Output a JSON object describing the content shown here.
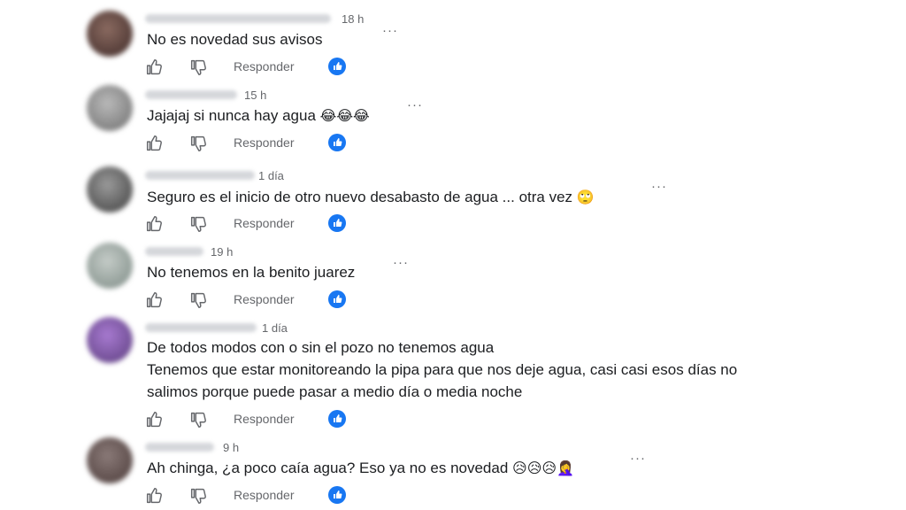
{
  "reply_label": "Responder",
  "more_label": "···",
  "colors": {
    "accent": "#1877f2",
    "muted": "#65676b",
    "text": "#1c1e21"
  },
  "comments": [
    {
      "time": "18 h",
      "lines": [
        "No es novedad sus avisos"
      ],
      "emoji": ""
    },
    {
      "time": "15 h",
      "lines": [
        "Jajajaj si nunca hay agua"
      ],
      "emoji": "😂😂😂"
    },
    {
      "time": "1 día",
      "lines": [
        "Seguro es el inicio de otro nuevo desabasto de agua ... otra vez"
      ],
      "emoji": "🙄"
    },
    {
      "time": "19 h",
      "lines": [
        "No tenemos en la benito juarez"
      ],
      "emoji": ""
    },
    {
      "time": "1 día",
      "lines": [
        "De todos modos con o sin el pozo no tenemos agua",
        "Tenemos que estar monitoreando la pipa para que nos deje agua, casi casi esos días no",
        "salimos porque puede pasar a medio día o media noche"
      ],
      "emoji": ""
    },
    {
      "time": "9 h",
      "lines": [
        "Ah chinga, ¿a poco caía agua? Eso ya no es novedad"
      ],
      "emoji": "😥😥😥🤦‍♀️"
    }
  ]
}
